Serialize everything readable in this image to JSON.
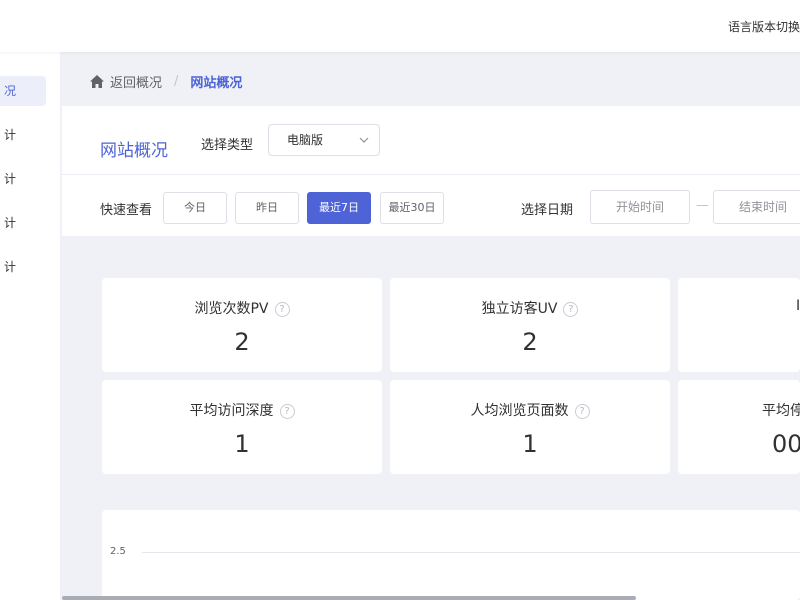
{
  "topbar": {
    "language_switch": "语言版本切换"
  },
  "sidebar": {
    "items": [
      {
        "label": "况",
        "active": true
      },
      {
        "label": "计"
      },
      {
        "label": "计"
      },
      {
        "label": "计"
      },
      {
        "label": "计"
      }
    ]
  },
  "breadcrumb": {
    "back": "返回概况",
    "separator": "/",
    "current": "网站概况"
  },
  "panel": {
    "title": "网站概况",
    "type_label": "选择类型",
    "type_value": "电脑版",
    "quick_label": "快速查看",
    "quick_buttons": [
      "今日",
      "昨日",
      "最近7日",
      "最近30日"
    ],
    "active_quick": "最近7日",
    "date_label": "选择日期",
    "start_placeholder": "开始时间",
    "date_separator": "—",
    "end_placeholder": "结束时间"
  },
  "stats": [
    {
      "label": "浏览次数PV",
      "value": "2"
    },
    {
      "label": "独立访客UV",
      "value": "2"
    },
    {
      "label": "I",
      "value": ""
    },
    {
      "label": "平均访问深度",
      "value": "1"
    },
    {
      "label": "人均浏览页面数",
      "value": "1"
    },
    {
      "label": "平均停",
      "value": "00"
    }
  ],
  "chart": {
    "y_tick": "2.5"
  },
  "colors": {
    "accent": "#4e63d6",
    "background": "#f0f1f6"
  },
  "icons": {
    "home": "home-icon",
    "dropdown": "chevron-down-icon",
    "help": "question-circle-icon"
  }
}
